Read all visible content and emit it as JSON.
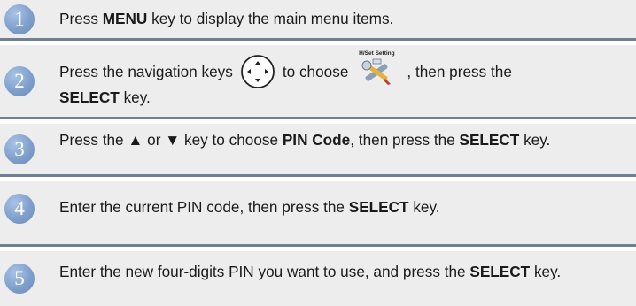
{
  "steps": [
    {
      "number": "1",
      "parts": {
        "a": "Press ",
        "b": "MENU",
        "c": " key to display the main menu items."
      }
    },
    {
      "number": "2",
      "parts": {
        "a": "Press the navigation keys",
        "b": "to choose",
        "c": ", then press the",
        "d": "SELECT",
        "e": " key."
      },
      "nav_icon": "navigation-keys-icon",
      "tool_icon": "setup-tools-icon",
      "tool_caption": "H/Set Setting"
    },
    {
      "number": "3",
      "parts": {
        "a": "Press the ▲ or ▼ key to choose ",
        "b": "PIN Code",
        "c": ", then press the ",
        "d": "SELECT",
        "e": " key."
      }
    },
    {
      "number": "4",
      "parts": {
        "a": "Enter the current PIN code, then press the ",
        "b": "SELECT",
        "c": " key."
      }
    },
    {
      "number": "5",
      "parts": {
        "a": "Enter the new four-digits PIN you want to use, and press the ",
        "b": "SELECT",
        "c": " key."
      }
    }
  ],
  "colors": {
    "band": "#ededed",
    "rule": "#6e7f96",
    "circle": "#7f9fcb"
  }
}
